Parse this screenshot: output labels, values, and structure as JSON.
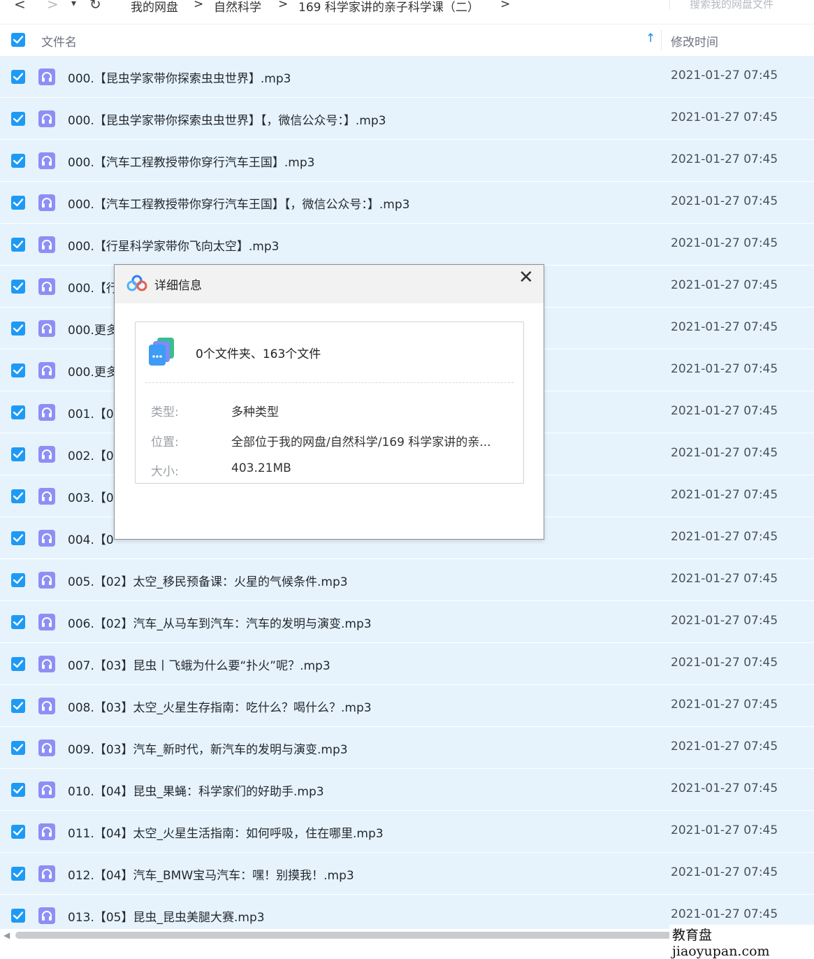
{
  "nav": {
    "back_glyph": "<",
    "forward_glyph": ">",
    "dropdown_glyph": "▾",
    "refresh_glyph": "↻",
    "breadcrumb": [
      "我的网盘",
      "自然科学",
      "169 科学家讲的亲子科学课（二）"
    ],
    "separator": ">",
    "search_placeholder": "搜索我的网盘文件"
  },
  "header": {
    "name_label": "文件名",
    "time_label": "修改时间",
    "sort_glyph": "↑"
  },
  "files": [
    {
      "name": "000.【昆虫学家带你探索虫虫世界】.mp3",
      "time": "2021-01-27 07:45"
    },
    {
      "name": "000.【昆虫学家带你探索虫虫世界】【，微信公众号：】.mp3",
      "time": "2021-01-27 07:45"
    },
    {
      "name": "000.【汽车工程教授带你穿行汽车王国】.mp3",
      "time": "2021-01-27 07:45"
    },
    {
      "name": "000.【汽车工程教授带你穿行汽车王国】【，微信公众号：】.mp3",
      "time": "2021-01-27 07:45"
    },
    {
      "name": "000.【行星科学家带你飞向太空】.mp3",
      "time": "2021-01-27 07:45"
    },
    {
      "name": "000.【行",
      "time": "2021-01-27 07:45"
    },
    {
      "name": "000.更多",
      "time": "2021-01-27 07:45"
    },
    {
      "name": "000.更多",
      "time": "2021-01-27 07:45"
    },
    {
      "name": "001.【0",
      "time": "2021-01-27 07:45"
    },
    {
      "name": "002.【0",
      "time": "2021-01-27 07:45"
    },
    {
      "name": "003.【0",
      "time": "2021-01-27 07:45"
    },
    {
      "name": "004.【0",
      "time": "2021-01-27 07:45"
    },
    {
      "name": "005.【02】太空_移民预备课：火星的气候条件.mp3",
      "time": "2021-01-27 07:45"
    },
    {
      "name": "006.【02】汽车_从马车到汽车：汽车的发明与演变.mp3",
      "time": "2021-01-27 07:45"
    },
    {
      "name": "007.【03】昆虫丨飞蛾为什么要“扑火”呢？.mp3",
      "time": "2021-01-27 07:45"
    },
    {
      "name": "008.【03】太空_火星生存指南：吃什么？喝什么？.mp3",
      "time": "2021-01-27 07:45"
    },
    {
      "name": "009.【03】汽车_新时代，新汽车的发明与演变.mp3",
      "time": "2021-01-27 07:45"
    },
    {
      "name": "010.【04】昆虫_果蝇：科学家们的好助手.mp3",
      "time": "2021-01-27 07:45"
    },
    {
      "name": "011.【04】太空_火星生活指南：如何呼吸，住在哪里.mp3",
      "time": "2021-01-27 07:45"
    },
    {
      "name": "012.【04】汽车_BMW宝马汽车：嘿！别摸我！.mp3",
      "time": "2021-01-27 07:45"
    },
    {
      "name": "013.【05】昆虫_昆虫美腿大赛.mp3",
      "time": "2021-01-27 07:45"
    }
  ],
  "dialog": {
    "title": "详细信息",
    "close_glyph": "✕",
    "summary": "0个文件夹、163个文件",
    "type_label": "类型:",
    "type_value": "多种类型",
    "location_label": "位置:",
    "location_value": "全部位于我的网盘/自然科学/169 科学家讲的亲...",
    "size_label": "大小:",
    "size_value": "403.21MB"
  },
  "watermark": "教育盘 jiaoyupan.com",
  "colors": {
    "checkbox": "#1e9af5",
    "row_selected": "#e6f3fd",
    "audio_icon": "#8e8ff5",
    "sort_arrow": "#1e88e5"
  },
  "icons": {
    "file": "headphones-icon",
    "dialog_logo": "baidu-cloud-logo-icon",
    "summary": "file-stack-icon"
  }
}
